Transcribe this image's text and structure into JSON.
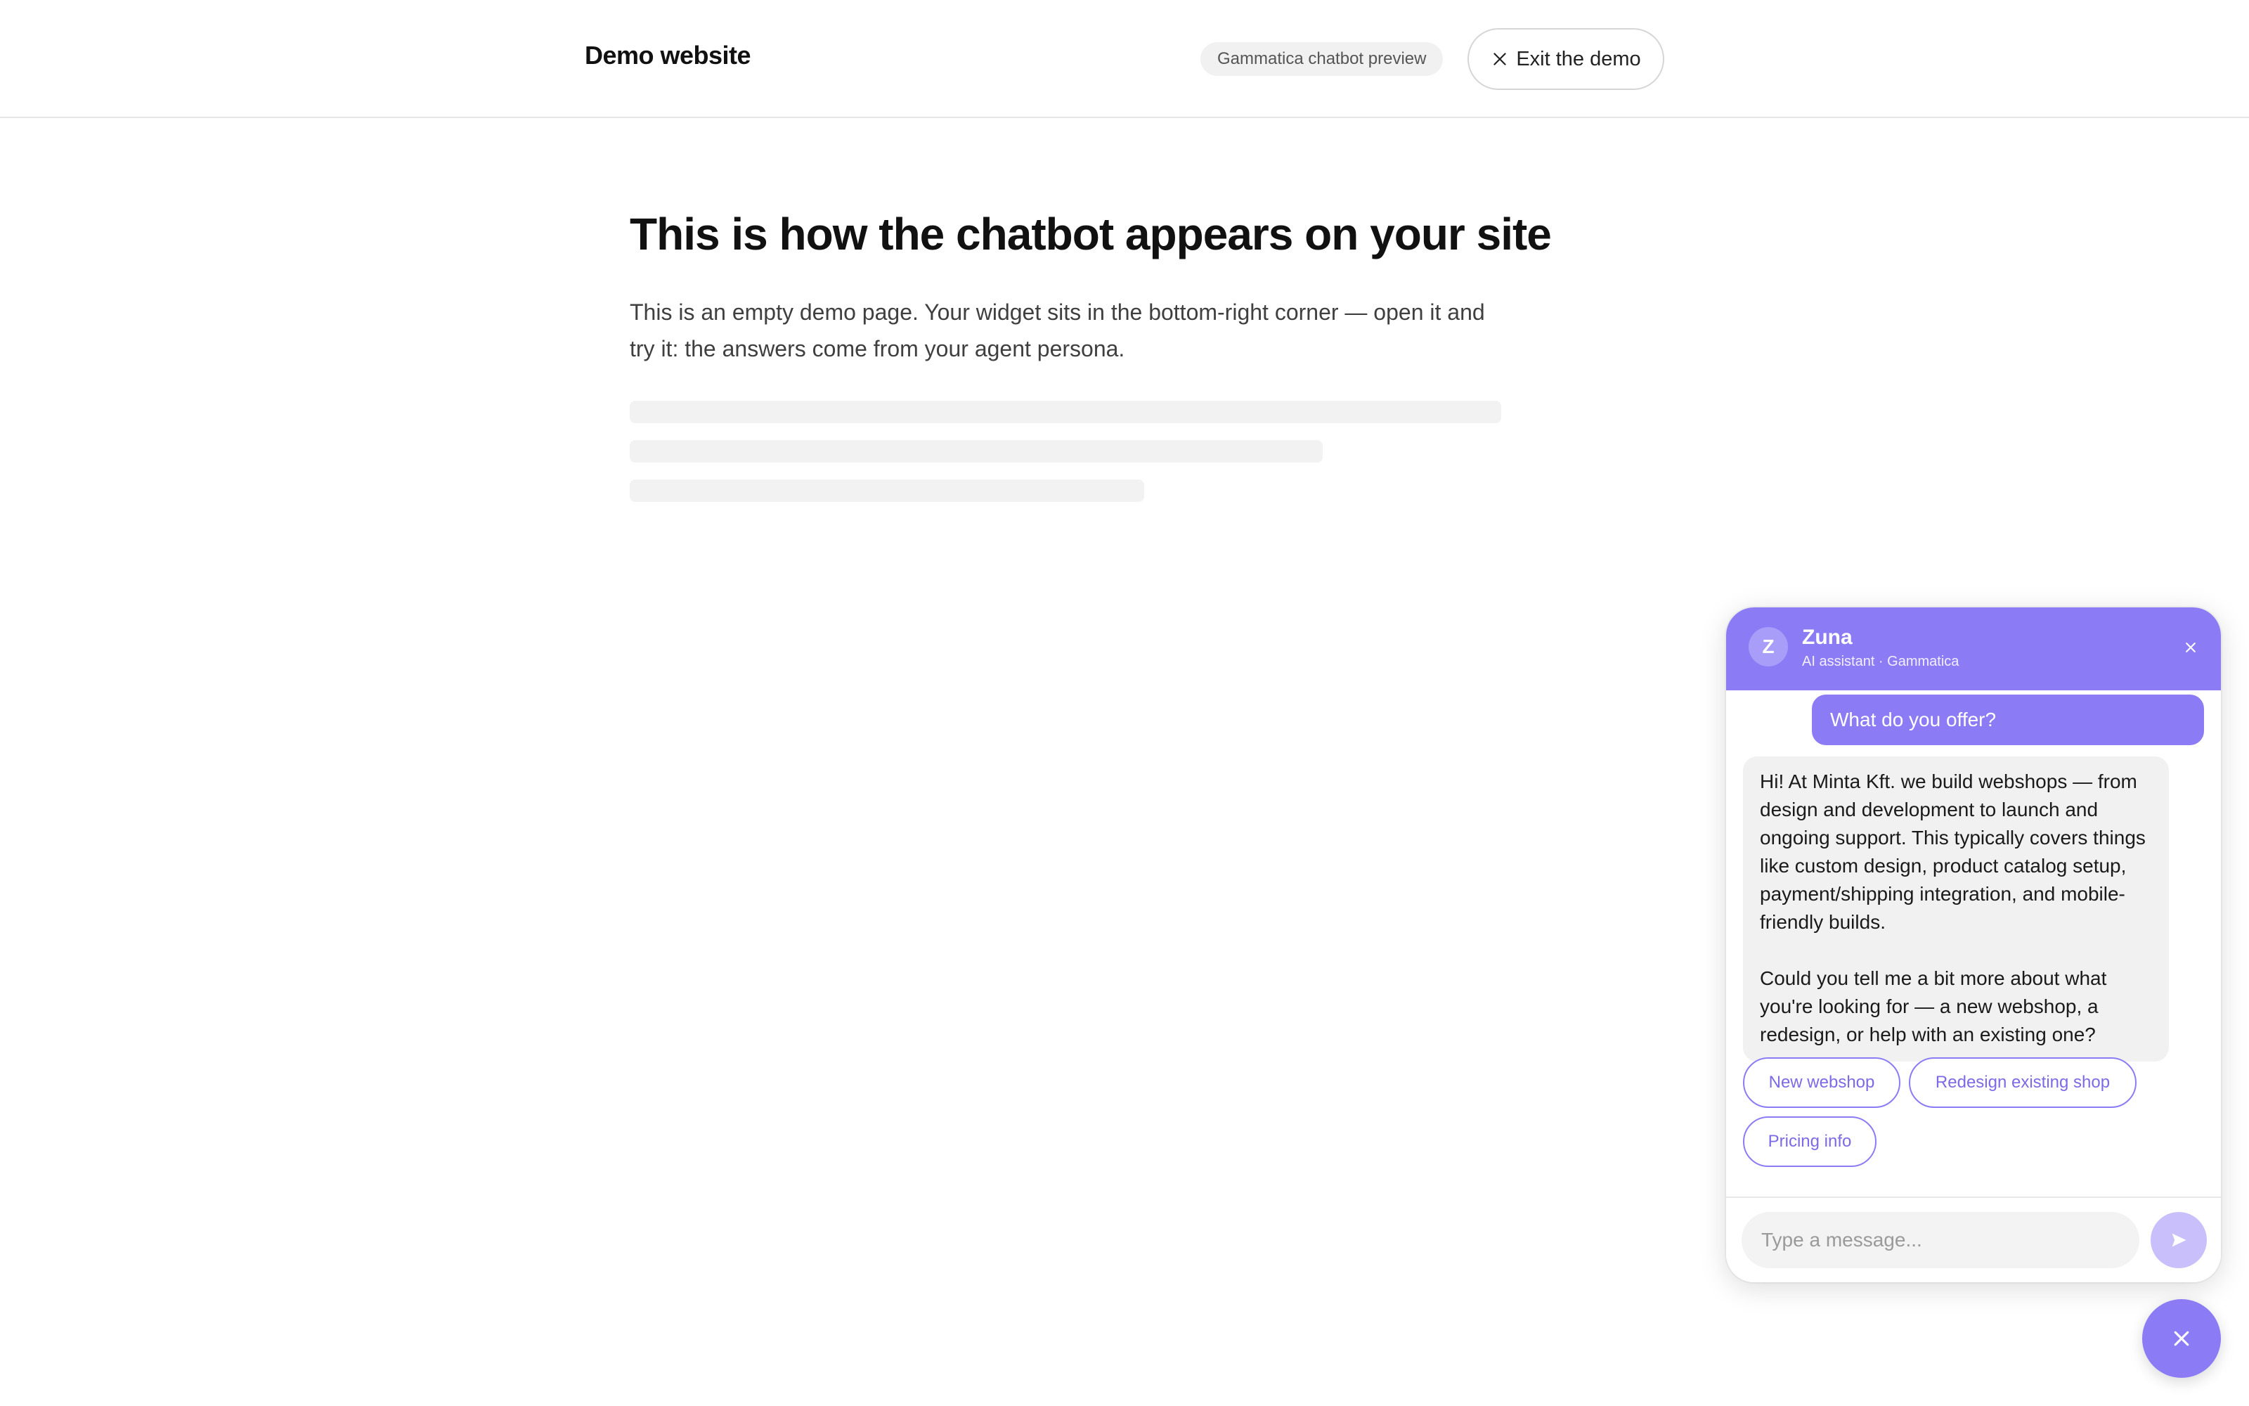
{
  "header": {
    "brand": "Demo website",
    "preview_badge": "Gammatica chatbot preview",
    "exit_label": "Exit the demo"
  },
  "main": {
    "headline": "This is how the chatbot appears on your site",
    "intro": "This is an empty demo page. Your widget sits in the bottom-right corner — open it and try it: the answers come from your agent persona."
  },
  "widget": {
    "avatar_initial": "Z",
    "agent_name": "Zuna",
    "agent_subtitle": "AI assistant · Gammatica",
    "close_icon": "close-icon",
    "messages": {
      "user": "What do you offer?",
      "bot_paragraph_1": "Hi! At Minta Kft. we build webshops — from design and development to launch and ongoing support. This typically covers things like custom design, product catalog setup, payment/shipping integration, and mobile-friendly builds.",
      "bot_paragraph_2": "Could you tell me a bit more about what you're looking for — a new webshop, a redesign, or help with an existing one?"
    },
    "quick_replies": [
      "New webshop",
      "Redesign existing shop",
      "Pricing info"
    ],
    "input": {
      "value": "",
      "placeholder": "Type a message..."
    },
    "send_icon": "send-icon",
    "launcher_icon": "close-icon"
  },
  "colors": {
    "accent": "#8b7cf6",
    "accent_light": "#c9c0fb",
    "bot_bubble": "#f1f1f1",
    "text_primary": "#111111"
  }
}
